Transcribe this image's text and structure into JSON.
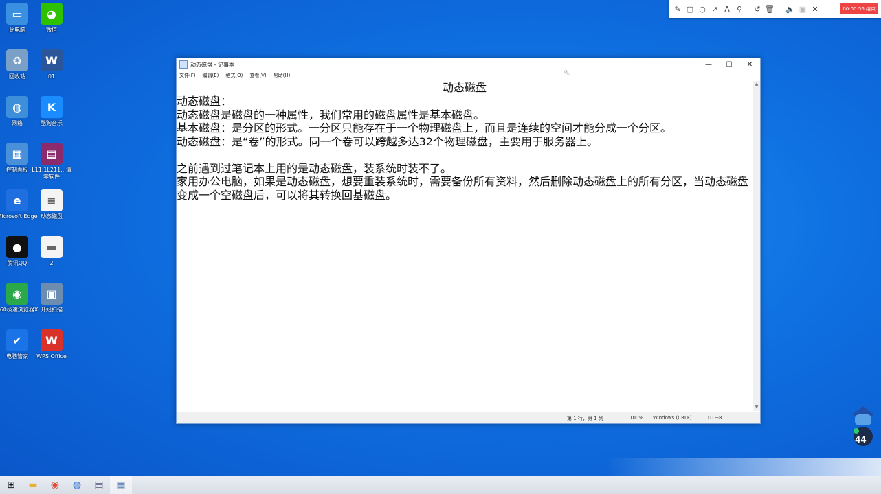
{
  "desktop": {
    "icons": [
      {
        "label": "此电脑",
        "icon": "computer-icon",
        "color": "#3b8fe0"
      },
      {
        "label": "微信",
        "icon": "wechat-icon",
        "color": "#2dc100"
      },
      {
        "label": "回收站",
        "icon": "recycle-bin-icon",
        "color": "#7aa0c8"
      },
      {
        "label": "01",
        "icon": "word-doc-icon",
        "color": "#2b579a"
      },
      {
        "label": "网络",
        "icon": "network-icon",
        "color": "#3c8fd8"
      },
      {
        "label": "酷狗音乐",
        "icon": "kugou-icon",
        "color": "#1a8cff"
      },
      {
        "label": "控制面板",
        "icon": "control-panel-icon",
        "color": "#4a90d9"
      },
      {
        "label": "L11.1L211...清零软件",
        "icon": "winrar-icon",
        "color": "#8b2b6b"
      },
      {
        "label": "Microsoft Edge",
        "icon": "edge-icon",
        "color": "#1f6fe0"
      },
      {
        "label": "动态磁盘",
        "icon": "text-file-icon",
        "color": "#f4f4f4"
      },
      {
        "label": "腾讯QQ",
        "icon": "qq-icon",
        "color": "#111111"
      },
      {
        "label": "2",
        "icon": "notepad-file-icon",
        "color": "#f4f4f4"
      },
      {
        "label": "360极速浏览器X",
        "icon": "browser-360-icon",
        "color": "#2aa84a"
      },
      {
        "label": "开始扫描",
        "icon": "scanner-icon",
        "color": "#6c8cb0"
      },
      {
        "label": "电脑管家",
        "icon": "pc-manager-icon",
        "color": "#1a74e8"
      },
      {
        "label": "WPS Office",
        "icon": "wps-icon",
        "color": "#d9322b"
      }
    ]
  },
  "recorder": {
    "tools": [
      "pencil-icon",
      "rectangle-icon",
      "circle-icon",
      "arrow-icon",
      "text-icon",
      "marker-icon",
      "undo-icon",
      "trash-icon",
      "volume-icon",
      "camera-icon",
      "close-icon"
    ],
    "timer": "00:00:56 结束"
  },
  "notepad": {
    "title": "动态磁盘 - 记事本",
    "menu": [
      "文件(F)",
      "编辑(E)",
      "格式(O)",
      "查看(V)",
      "帮助(H)"
    ],
    "doc_title": "动态磁盘",
    "lines": [
      "动态磁盘：",
      "动态磁盘是磁盘的一种属性，我们常用的磁盘属性是基本磁盘。",
      "基本磁盘：是分区的形式。一分区只能存在于一个物理磁盘上，而且是连续的空间才能分成一个分区。",
      "动态磁盘：是“卷”的形式。同一个卷可以跨越多达32个物理磁盘，主要用于服务器上。",
      "",
      "之前遇到过笔记本上用的是动态磁盘，装系统时装不了。",
      "家用办公电脑，如果是动态磁盘，想要重装系统时，需要备份所有资料，然后删除动态磁盘上的所有分区，当动态磁盘变成一个空磁盘后，可以将其转换回基磁盘。"
    ],
    "status": {
      "position": "第 1 行，第 1 列",
      "zoom": "100%",
      "line_ending": "Windows (CRLF)",
      "encoding": "UTF-8"
    }
  },
  "overlay": {
    "badge_number": "44"
  },
  "taskbar": {
    "items": [
      "windows-start-icon",
      "file-explorer-icon",
      "chrome-icon",
      "app-icon",
      "scanner-icon",
      "notepad-icon"
    ]
  }
}
